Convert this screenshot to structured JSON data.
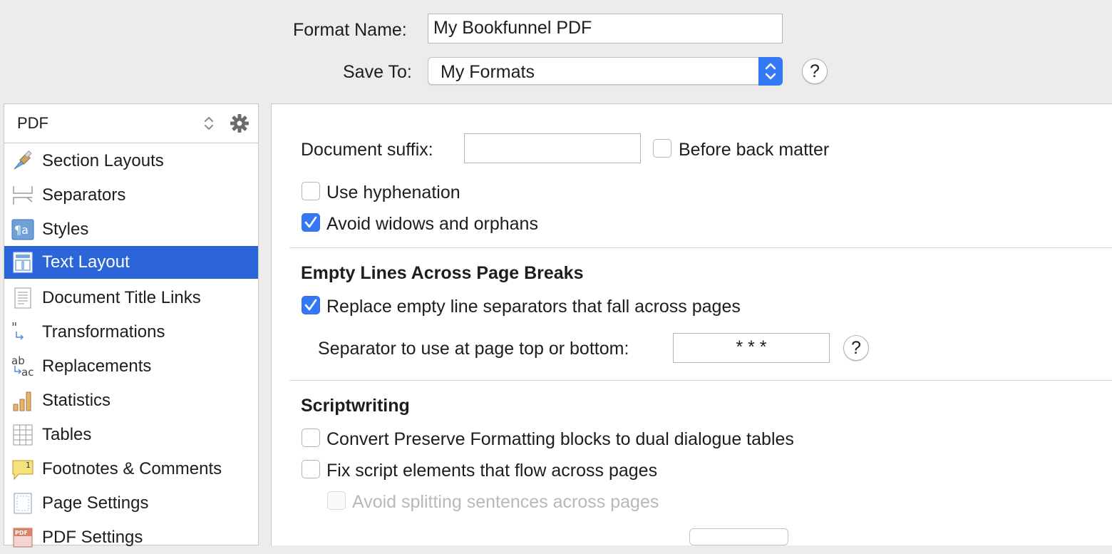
{
  "header": {
    "format_name_label": "Format Name:",
    "format_name_value": "My Bookfunnel PDF",
    "save_to_label": "Save To:",
    "save_to_value": "My Formats",
    "help_label": "?"
  },
  "sidebar": {
    "format_type": "PDF",
    "items": [
      {
        "label": "Section Layouts",
        "icon": "paintbrush-icon"
      },
      {
        "label": "Separators",
        "icon": "separators-icon"
      },
      {
        "label": "Styles",
        "icon": "styles-icon"
      },
      {
        "label": "Text Layout",
        "icon": "text-layout-icon",
        "selected": true
      },
      {
        "label": "Document Title Links",
        "icon": "document-icon"
      },
      {
        "label": "Transformations",
        "icon": "quotes-transform-icon"
      },
      {
        "label": "Replacements",
        "icon": "replacements-icon"
      },
      {
        "label": "Statistics",
        "icon": "bar-chart-icon"
      },
      {
        "label": "Tables",
        "icon": "table-grid-icon"
      },
      {
        "label": "Footnotes & Comments",
        "icon": "footnote-comment-icon"
      },
      {
        "label": "Page Settings",
        "icon": "page-settings-icon"
      },
      {
        "label": "PDF Settings",
        "icon": "pdf-icon"
      }
    ]
  },
  "main": {
    "document_suffix_label": "Document suffix:",
    "document_suffix_value": "",
    "before_back_matter": {
      "label": "Before back matter",
      "checked": false
    },
    "use_hyphenation": {
      "label": "Use hyphenation",
      "checked": false
    },
    "avoid_widows": {
      "label": "Avoid widows and orphans",
      "checked": true
    },
    "empty_lines_heading": "Empty Lines Across Page Breaks",
    "replace_empty": {
      "label": "Replace empty line separators that fall across pages",
      "checked": true
    },
    "separator_label": "Separator to use at page top or bottom:",
    "separator_value": "* * *",
    "help_label": "?",
    "scriptwriting_heading": "Scriptwriting",
    "convert_preserve": {
      "label": "Convert Preserve Formatting blocks to dual dialogue tables",
      "checked": false
    },
    "fix_script": {
      "label": "Fix script elements that flow across pages",
      "checked": false
    },
    "avoid_splitting": {
      "label": "Avoid splitting sentences across pages",
      "checked": false,
      "disabled": true
    }
  },
  "colors": {
    "accent": "#3478f6",
    "selection": "#2c64d9",
    "window_bg": "#ececec"
  }
}
